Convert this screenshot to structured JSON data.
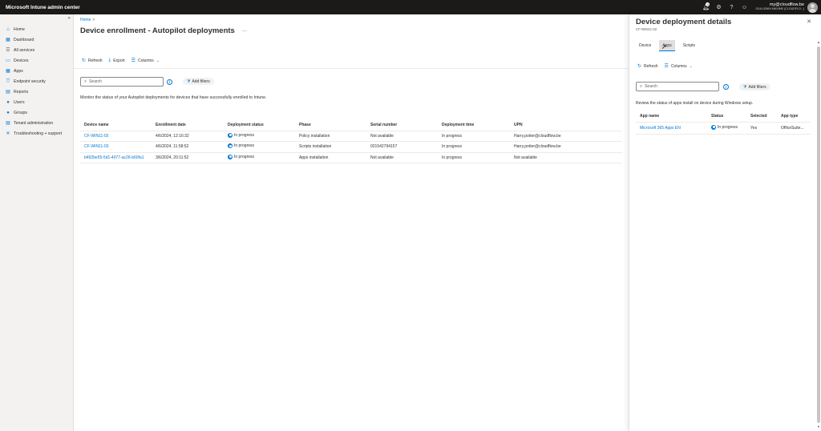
{
  "app": {
    "title": "Microsoft Intune admin center"
  },
  "topbar": {
    "notification_count": "1",
    "icons": [
      "bell-icon",
      "gear-icon",
      "help-icon",
      "feedback-icon"
    ],
    "account_email": "my@cloudflow.be",
    "account_org": "GUILLEMIN MAXIME (CLOUDFLO...)"
  },
  "sidebar": {
    "collapse_glyph": "«",
    "items": [
      {
        "label": "Home",
        "icon": "home-icon",
        "glyph": "⌂",
        "color": "#0078d4"
      },
      {
        "label": "Dashboard",
        "icon": "dashboard-icon",
        "glyph": "▦",
        "color": "#0078d4"
      },
      {
        "label": "All services",
        "icon": "all-services-icon",
        "glyph": "☰",
        "color": "#605e5c"
      },
      {
        "label": "Devices",
        "icon": "devices-icon",
        "glyph": "▭",
        "color": "#0078d4"
      },
      {
        "label": "Apps",
        "icon": "apps-icon",
        "glyph": "▦",
        "color": "#0078d4"
      },
      {
        "label": "Endpoint security",
        "icon": "shield-icon",
        "glyph": "⛉",
        "color": "#0078d4"
      },
      {
        "label": "Reports",
        "icon": "reports-icon",
        "glyph": "▤",
        "color": "#0078d4"
      },
      {
        "label": "Users",
        "icon": "users-icon",
        "glyph": "●",
        "color": "#0078d4"
      },
      {
        "label": "Groups",
        "icon": "groups-icon",
        "glyph": "●",
        "color": "#0078d4"
      },
      {
        "label": "Tenant administration",
        "icon": "tenant-admin-icon",
        "glyph": "▤",
        "color": "#0078d4"
      },
      {
        "label": "Troubleshooting + support",
        "icon": "troubleshooting-icon",
        "glyph": "✕",
        "color": "#0078d4"
      }
    ]
  },
  "main": {
    "breadcrumb_home": "Home",
    "breadcrumb_sep": ">",
    "title": "Device enrollment - Autopilot deployments",
    "more": "...",
    "toolbar": {
      "refresh": "Refresh",
      "export": "Export",
      "columns": "Columns"
    },
    "search_placeholder": "Search",
    "add_filters": "Add filters",
    "description": "Monitor the status of your Autopilot deployments for devices that have successfully enrolled to Intune.",
    "columns": [
      "Device name",
      "Enrollment date",
      "Deployment status",
      "Phase",
      "Serial number",
      "Deployment time",
      "UPN"
    ],
    "rows": [
      {
        "device": "CF-WIN11-02",
        "date": "4/6/2024, 12:16:32",
        "status": "In progress",
        "phase": "Policy installation",
        "serial": "Not available",
        "time": "In progress",
        "upn": "Harry.potter@cloudflow.be"
      },
      {
        "device": "CF-WIN11-03",
        "date": "4/6/2024, 11:58:52",
        "status": "In progress",
        "phase": "Scripts installation",
        "serial": "021542794157",
        "time": "In progress",
        "upn": "Harry.potter@cloudflow.be"
      },
      {
        "device": "b492be55-5d1-4077-ac26-b60fa1",
        "date": "3/6/2024, 20:11:52",
        "status": "In progress",
        "phase": "Apps installation",
        "serial": "Not available",
        "time": "In progress",
        "upn": "Not available"
      }
    ]
  },
  "panel": {
    "title": "Device deployment details",
    "subtitle": "CF-WIN11-02",
    "close": "✕",
    "tabs": [
      "Device",
      "Apps",
      "Scripts"
    ],
    "active_tab": "Apps",
    "toolbar": {
      "refresh": "Refresh",
      "columns": "Columns"
    },
    "search_placeholder": "Search",
    "add_filters": "Add filters",
    "description": "Review the status of apps install on device during Windows setup.",
    "columns": [
      "App name",
      "Status",
      "Selected",
      "App type"
    ],
    "rows": [
      {
        "app": "Microsoft 365 Apps EN",
        "status": "In progress",
        "selected": "Yes",
        "type": "OfficeSuite..."
      }
    ]
  },
  "colors": {
    "accent": "#0078d4",
    "topbar": "#1b1a19",
    "sidebar": "#f3f2f1"
  }
}
